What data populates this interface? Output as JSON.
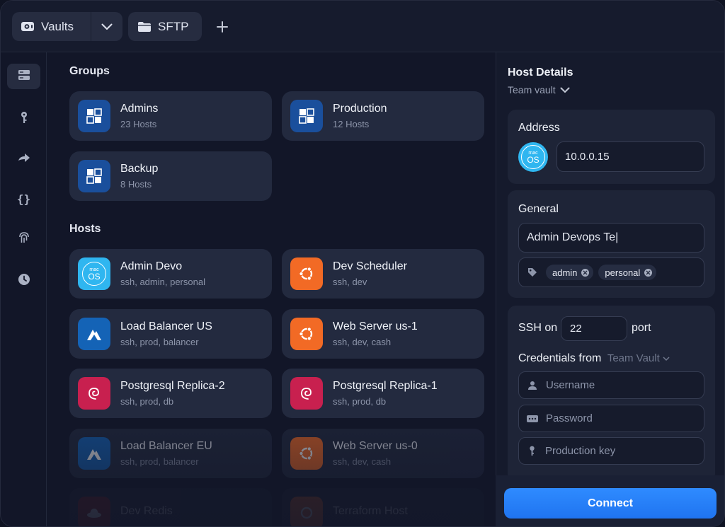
{
  "topbar": {
    "vaults_label": "Vaults",
    "sftp_label": "SFTP"
  },
  "rail": {
    "icons": [
      "hosts-icon",
      "key-icon",
      "port-forward-icon",
      "snippets-icon",
      "fingerprint-icon",
      "history-icon"
    ]
  },
  "groups": {
    "title": "Groups",
    "items": [
      {
        "name": "Admins",
        "sub": "23 Hosts"
      },
      {
        "name": "Production",
        "sub": "12 Hosts"
      },
      {
        "name": "Backup",
        "sub": "8 Hosts"
      }
    ]
  },
  "hosts": {
    "title": "Hosts",
    "items": [
      {
        "name": "Admin Devo",
        "sub": "ssh, admin, personal",
        "os": "macos"
      },
      {
        "name": "Dev Scheduler",
        "sub": "ssh, dev",
        "os": "ubuntu"
      },
      {
        "name": "Load Balancer US",
        "sub": "ssh, prod, balancer",
        "os": "alpine"
      },
      {
        "name": "Web Server us-1",
        "sub": "ssh, dev, cash",
        "os": "ubuntu"
      },
      {
        "name": "Postgresql Replica-2",
        "sub": "ssh, prod, db",
        "os": "debian"
      },
      {
        "name": "Postgresql Replica-1",
        "sub": "ssh, prod, db",
        "os": "debian"
      },
      {
        "name": "Load Balancer EU",
        "sub": "ssh, prod, balancer",
        "os": "alpine"
      },
      {
        "name": "Web Server us-0",
        "sub": "ssh, dev, cash",
        "os": "ubuntu"
      },
      {
        "name": "Dev Redis",
        "sub": "",
        "os": "redhat"
      },
      {
        "name": "Terraform Host",
        "sub": "",
        "os": "ubuntu"
      }
    ]
  },
  "panel": {
    "title": "Host Details",
    "vault": "Team vault",
    "address_label": "Address",
    "address_value": "10.0.0.15",
    "macos_line1": "mac",
    "macos_line2": "OS",
    "general_label": "General",
    "label_value": "Admin Devops Te|",
    "tags": [
      "admin",
      "personal"
    ],
    "ssh_on": "SSH on",
    "port_value": "22",
    "port_label": "port",
    "credentials_from": "Credentials from",
    "credentials_vault": "Team Vault",
    "username_placeholder": "Username",
    "password_placeholder": "Password",
    "key_placeholder": "Production key",
    "connect": "Connect"
  },
  "colors": {
    "accent": "#2f8bff",
    "group_badge": "#1a4f9c",
    "macos": "#2fb6f0",
    "ubuntu": "#f26a25",
    "alpine": "#1463b6",
    "debian": "#c8204f",
    "redhat": "#a32222"
  }
}
